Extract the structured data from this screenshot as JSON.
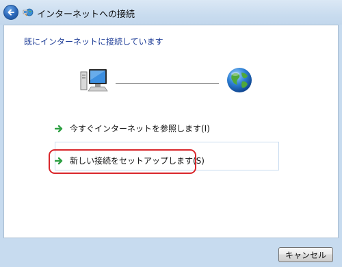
{
  "window": {
    "title": "インターネットへの接続",
    "icons": {
      "back": "back-arrow-icon",
      "app": "network-connection-icon"
    }
  },
  "main": {
    "status_heading": "既にインターネットに接続しています",
    "illustration": {
      "left": "computer-icon",
      "right": "globe-icon"
    },
    "options": [
      {
        "label": "今すぐインターネットを参照します(I)",
        "icon": "green-arrow-icon"
      },
      {
        "label": "新しい接続をセットアップします(S)",
        "icon": "green-arrow-icon",
        "highlighted": true
      }
    ]
  },
  "footer": {
    "cancel_label": "キャンセル"
  },
  "colors": {
    "heading": "#1e3d97",
    "highlight": "#d9262b",
    "arrow": "#2ea043",
    "frame": "#c7dbef"
  }
}
